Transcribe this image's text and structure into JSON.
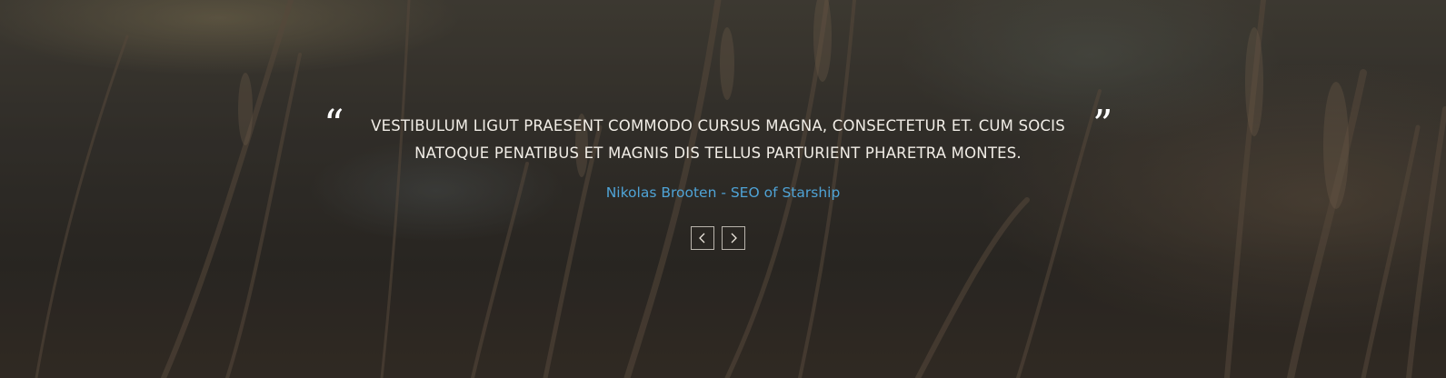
{
  "testimonial": {
    "open_quote": "“",
    "close_quote": "”",
    "text": "VESTIBULUM LIGUT PRAESENT COMMODO CURSUS MAGNA, CONSECTETUR ET. CUM SOCIS NATOQUE PENATIBUS ET MAGNIS DIS TELLUS PARTURIENT PHARETRA MONTES.",
    "author": "Nikolas Brooten - SEO of Starship"
  },
  "controls": {
    "prev_icon": "chevron-left-icon",
    "next_icon": "chevron-right-icon"
  },
  "colors": {
    "accent": "#4fa3d6",
    "text": "#f1ede6"
  }
}
